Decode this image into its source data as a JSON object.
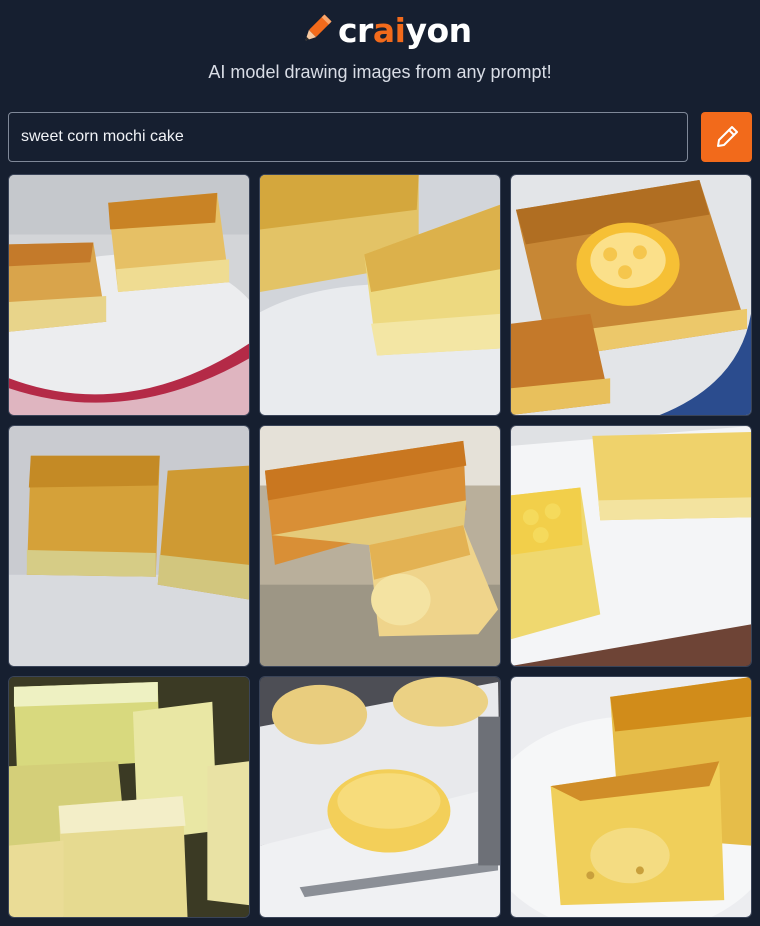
{
  "brand": {
    "prefix": "cr",
    "highlight": "ai",
    "suffix": "yon",
    "accent_color": "#f26a1b"
  },
  "tagline": "AI model drawing images from any prompt!",
  "search": {
    "value": "sweet corn mochi cake",
    "button_icon": "pencil-icon"
  },
  "results": [
    {
      "description": "corn cake squares on white plate with patterned cloth"
    },
    {
      "description": "two corn cake slices on white plate"
    },
    {
      "description": "corn cake topped with corn piece on plate"
    },
    {
      "description": "two corn cake bars on gray surface"
    },
    {
      "description": "corn cake pieces on beige cloth"
    },
    {
      "description": "corn cake squares on white square plate"
    },
    {
      "description": "sugar-dusted mochi squares stacked"
    },
    {
      "description": "round corn cakes with spoon"
    },
    {
      "description": "corn cake wedge on white plate"
    }
  ]
}
